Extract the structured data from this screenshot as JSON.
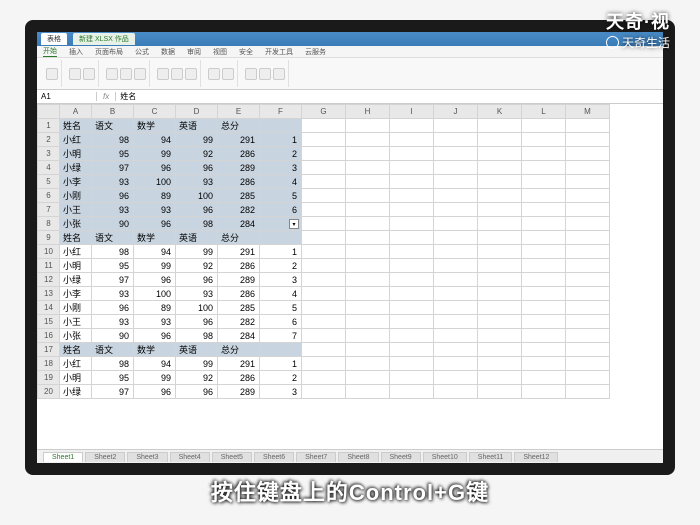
{
  "watermark": {
    "brand": "天奇·视",
    "sub": "天奇生活"
  },
  "subtitle": "按住键盘上的Control+G键",
  "titlebar": {
    "tab1": "表格",
    "tab2": "新建 XLSX 作品"
  },
  "ribbon_tabs": [
    "开始",
    "插入",
    "页面布局",
    "公式",
    "数据",
    "审阅",
    "视图",
    "安全",
    "开发工具",
    "云服务"
  ],
  "name_box": "A1",
  "fx_label": "fx",
  "cell_value": "姓名",
  "columns": [
    "A",
    "B",
    "C",
    "D",
    "E",
    "F",
    "G",
    "H",
    "I",
    "J",
    "K",
    "L",
    "M"
  ],
  "headers": [
    "姓名",
    "语文",
    "数学",
    "英语",
    "总分",
    ""
  ],
  "rows": [
    {
      "n": 1,
      "sel": true,
      "hdr": true,
      "c": [
        "姓名",
        "语文",
        "数学",
        "英语",
        "总分",
        ""
      ]
    },
    {
      "n": 2,
      "sel": true,
      "c": [
        "小红",
        "98",
        "94",
        "99",
        "291",
        "1"
      ]
    },
    {
      "n": 3,
      "sel": true,
      "c": [
        "小明",
        "95",
        "99",
        "92",
        "286",
        "2"
      ]
    },
    {
      "n": 4,
      "sel": true,
      "c": [
        "小绿",
        "97",
        "96",
        "96",
        "289",
        "3"
      ]
    },
    {
      "n": 5,
      "sel": true,
      "c": [
        "小李",
        "93",
        "100",
        "93",
        "286",
        "4"
      ]
    },
    {
      "n": 6,
      "sel": true,
      "c": [
        "小刚",
        "96",
        "89",
        "100",
        "285",
        "5"
      ]
    },
    {
      "n": 7,
      "sel": true,
      "c": [
        "小王",
        "93",
        "93",
        "96",
        "282",
        "6"
      ]
    },
    {
      "n": 8,
      "sel": true,
      "c": [
        "小张",
        "90",
        "96",
        "98",
        "284",
        "7"
      ]
    },
    {
      "n": 9,
      "hdr": true,
      "c": [
        "姓名",
        "语文",
        "数学",
        "英语",
        "总分",
        ""
      ]
    },
    {
      "n": 10,
      "c": [
        "小红",
        "98",
        "94",
        "99",
        "291",
        "1"
      ]
    },
    {
      "n": 11,
      "c": [
        "小明",
        "95",
        "99",
        "92",
        "286",
        "2"
      ]
    },
    {
      "n": 12,
      "c": [
        "小绿",
        "97",
        "96",
        "96",
        "289",
        "3"
      ]
    },
    {
      "n": 13,
      "c": [
        "小李",
        "93",
        "100",
        "93",
        "286",
        "4"
      ]
    },
    {
      "n": 14,
      "c": [
        "小刚",
        "96",
        "89",
        "100",
        "285",
        "5"
      ]
    },
    {
      "n": 15,
      "c": [
        "小王",
        "93",
        "93",
        "96",
        "282",
        "6"
      ]
    },
    {
      "n": 16,
      "c": [
        "小张",
        "90",
        "96",
        "98",
        "284",
        "7"
      ]
    },
    {
      "n": 17,
      "hdr": true,
      "c": [
        "姓名",
        "语文",
        "数学",
        "英语",
        "总分",
        ""
      ]
    },
    {
      "n": 18,
      "c": [
        "小红",
        "98",
        "94",
        "99",
        "291",
        "1"
      ]
    },
    {
      "n": 19,
      "c": [
        "小明",
        "95",
        "99",
        "92",
        "286",
        "2"
      ]
    },
    {
      "n": 20,
      "c": [
        "小绿",
        "97",
        "96",
        "96",
        "289",
        "3"
      ]
    }
  ],
  "sheets": [
    "Sheet1",
    "Sheet2",
    "Sheet3",
    "Sheet4",
    "Sheet5",
    "Sheet6",
    "Sheet7",
    "Sheet8",
    "Sheet9",
    "Sheet10",
    "Sheet11",
    "Sheet12"
  ],
  "active_sheet": 0
}
